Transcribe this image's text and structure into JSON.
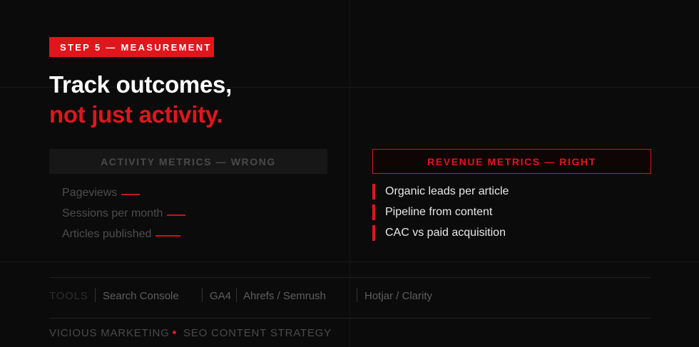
{
  "step": {
    "label": "STEP 5 — MEASUREMENT"
  },
  "headline": {
    "line1": "Track outcomes,",
    "line2": "not just activity."
  },
  "wrong_panel": {
    "title": "ACTIVITY METRICS — WRONG",
    "items": [
      "Pageviews",
      "Sessions per month",
      "Articles published"
    ]
  },
  "right_panel": {
    "title": "REVENUE METRICS — RIGHT",
    "items": [
      "Organic leads per article",
      "Pipeline from content",
      "CAC vs paid acquisition"
    ]
  },
  "tools": {
    "label": "TOOLS",
    "items": [
      "Search Console",
      "GA4",
      "Ahrefs / Semrush",
      "Hotjar / Clarity"
    ]
  },
  "footer": {
    "brand": "VICIOUS MARKETING",
    "title": "SEO CONTENT STRATEGY"
  },
  "colors": {
    "accent": "#e0161d",
    "background": "#0b0b0b"
  }
}
